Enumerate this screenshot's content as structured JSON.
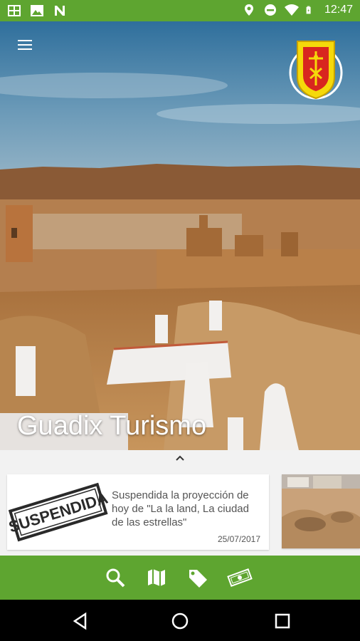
{
  "status_bar": {
    "time": "12:47",
    "left_icons": [
      "gallery-icon",
      "image-icon",
      "n-icon"
    ],
    "right_icons": [
      "location-icon",
      "do-not-disturb-icon",
      "wifi-icon",
      "battery-icon"
    ]
  },
  "hero": {
    "title": "Guadix Turismo",
    "menu_icon": "hamburger-menu-icon",
    "crest_icon": "guadix-coat-of-arms"
  },
  "news": {
    "expand_icon": "chevron-up-icon",
    "items": [
      {
        "image_icon": "suspendida-stamp",
        "stamp_text": "SUSPENDIDA",
        "text": "Suspendida la proyección de hoy de \"La la land, La ciudad de las estrellas\"",
        "date": "25/07/2017"
      },
      {
        "image_icon": "ruins-photo"
      }
    ]
  },
  "toolbar": {
    "buttons": [
      "search-icon",
      "map-icon",
      "tag-icon",
      "money-icon"
    ]
  },
  "nav": {
    "buttons": [
      "back-icon",
      "home-icon",
      "recents-icon"
    ]
  },
  "colors": {
    "brand_green": "#5ea530",
    "nav_black": "#000000"
  }
}
